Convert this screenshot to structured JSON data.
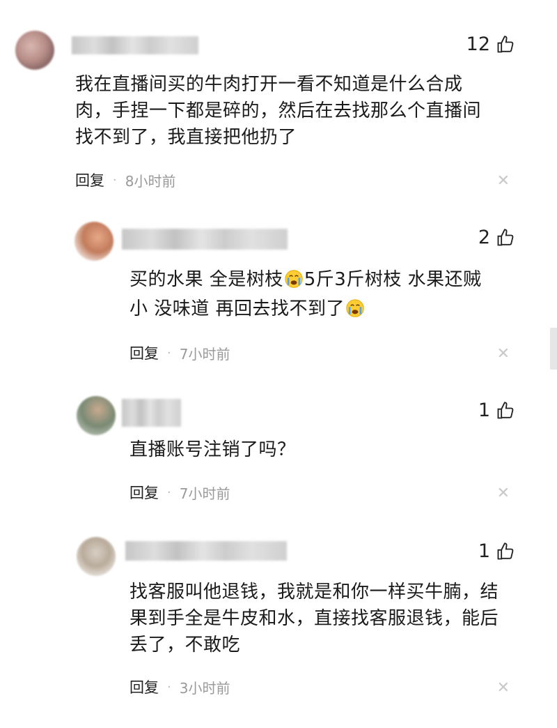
{
  "comments": [
    {
      "likes": "12",
      "text_lines": [
        "我在直播间买的牛肉打开一看不知道是什么合成",
        "肉，手捏一下都是碎的，然后在去找那么个直播间",
        "找不到了，我直接把他扔了"
      ],
      "reply_label": "回复",
      "time": "8小时前"
    },
    {
      "likes": "2",
      "text_parts": [
        "买的水果 全是树枝",
        "5斤3斤树枝 水果还贼",
        "小 没味道 再回去找不到了"
      ],
      "reply_label": "回复",
      "time": "7小时前"
    },
    {
      "likes": "1",
      "text_lines": [
        "直播账号注销了吗？"
      ],
      "reply_label": "回复",
      "time": "7小时前"
    },
    {
      "likes": "1",
      "text_lines": [
        "找客服叫他退钱，我就是和你一样买牛腩，结",
        "果到手全是牛皮和水，直接找客服退钱，能后",
        "丢了，不敢吃"
      ],
      "reply_label": "回复",
      "time": "3小时前"
    }
  ],
  "icons": {
    "like": "thumbs-up-icon",
    "close": "close-icon",
    "emoji": "crying-face-emoji"
  }
}
